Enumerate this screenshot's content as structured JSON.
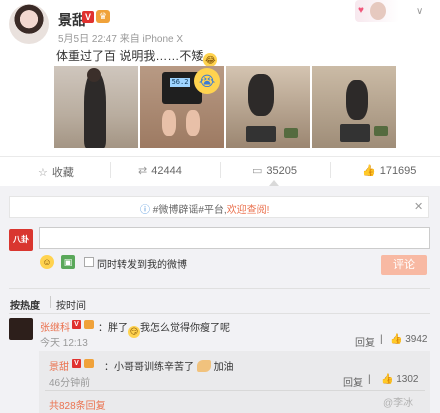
{
  "post": {
    "author": "景甜",
    "verified_badge": "V",
    "meta": "5月5日 22:47 来自 iPhone X",
    "text": "体重过了百 说明我……不矮",
    "text_emoji": "laugh-cry-emoji",
    "scale_readout": "56.2"
  },
  "actions": {
    "favorite_label": "收藏",
    "repost_count": "42444",
    "comment_count": "35205",
    "like_count": "171695"
  },
  "compose": {
    "notice_prefix": "#微博辟谣#平台,",
    "notice_link": "欢迎查阅!",
    "my_avatar_text": "八卦",
    "also_repost_label": "同时转发到我的微博",
    "submit_label": "评论"
  },
  "sort": {
    "hot": "按热度",
    "time": "按时间"
  },
  "comments": [
    {
      "user": "张继科",
      "text": "：胖了",
      "text_tail": "我怎么觉得你瘦了呢",
      "time": "今天 12:13",
      "reply_label": "回复",
      "likes": "3942",
      "reply": {
        "user": "景甜",
        "text": "：小哥哥训练辛苦了",
        "text_tail": "加油",
        "time": "46分钟前",
        "reply_label": "回复",
        "likes": "1302"
      }
    }
  ],
  "more_replies": "共828条回复",
  "watermark": "@李冰"
}
